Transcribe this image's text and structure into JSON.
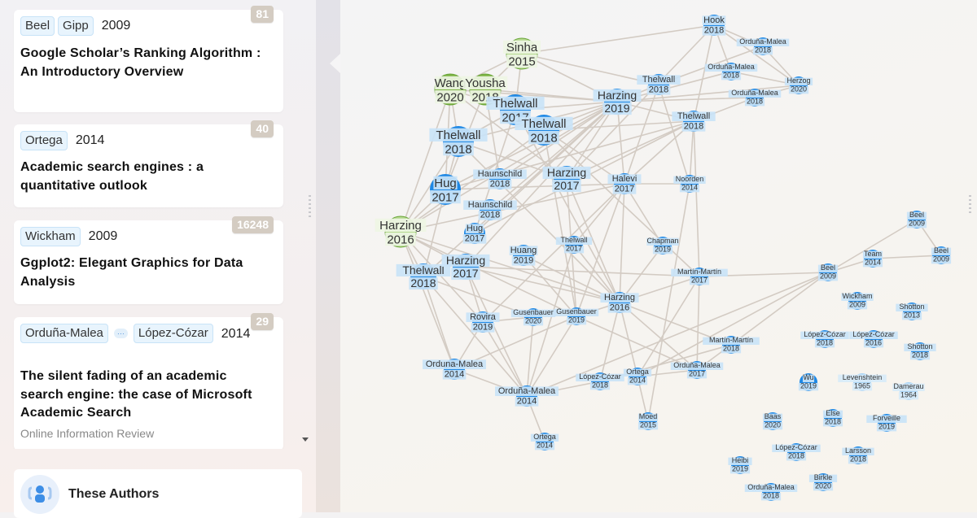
{
  "papers": [
    {
      "authors": [
        "Beel",
        "Gipp"
      ],
      "more_authors": false,
      "year": "2009",
      "title": "Google Scholar’s Ranking Algorithm : An Introductory Overview",
      "venue": "",
      "count": "81"
    },
    {
      "authors": [
        "Ortega"
      ],
      "more_authors": false,
      "year": "2014",
      "title": "Academic search engines : a quantitative outlook",
      "venue": "",
      "count": "40"
    },
    {
      "authors": [
        "Wickham"
      ],
      "more_authors": false,
      "year": "2009",
      "title": "Ggplot2: Elegant Graphics for Data Analysis",
      "venue": "",
      "count": "16248"
    },
    {
      "authors": [
        "Orduña-Malea",
        "López-Cózar"
      ],
      "more_authors": true,
      "more_label": "···",
      "year": "2014",
      "title": "The silent fading of an academic search engine: the case of Microsoft Academic Search",
      "venue": "Online Information Review",
      "count": "29"
    }
  ],
  "authors_panel": {
    "label": "These Authors",
    "icon": "people-group-icon"
  },
  "colors": {
    "node_blue": "#1e88e5",
    "node_light_blue": "#a9d4f5",
    "node_green": "#7cb342",
    "node_green_light": "#b5d98e",
    "edge": "#d3cbc3",
    "count_badge": "#d4ccc2",
    "chip_bg": "#e8f4fd"
  },
  "graph": {
    "nodes": [
      {
        "id": "sinha2015",
        "author": "Sinha",
        "year": "2015",
        "type": "origin-light",
        "size": "lg"
      },
      {
        "id": "wang2020",
        "author": "Wang",
        "year": "2020",
        "type": "origin",
        "size": "lg"
      },
      {
        "id": "yousha2018",
        "author": "Yousha",
        "year": "2018",
        "type": "origin",
        "size": "lg"
      },
      {
        "id": "thelwall2017a",
        "author": "Thelwall",
        "year": "2017",
        "type": "blue",
        "size": "lg"
      },
      {
        "id": "thelwall2018a",
        "author": "Thelwall",
        "year": "2018",
        "type": "blue",
        "size": "lg"
      },
      {
        "id": "thelwall2018b",
        "author": "Thelwall",
        "year": "2018",
        "type": "blue",
        "size": "lg"
      },
      {
        "id": "hug2017a",
        "author": "Hug",
        "year": "2017",
        "type": "blue",
        "size": "lg"
      },
      {
        "id": "harzing2016a",
        "author": "Harzing",
        "year": "2016",
        "type": "origin-light",
        "size": "lg"
      },
      {
        "id": "thelwall2018c",
        "author": "Thelwall",
        "year": "2018",
        "type": "blue",
        "size": "md"
      },
      {
        "id": "harzing2017a",
        "author": "Harzing",
        "year": "2017",
        "type": "blue",
        "size": "md"
      },
      {
        "id": "haunschild2018a",
        "author": "Haunschild",
        "year": "2018",
        "type": "blue",
        "size": "sm"
      },
      {
        "id": "haunschild2018b",
        "author": "Haunschild",
        "year": "2018",
        "type": "blue",
        "size": "sm"
      },
      {
        "id": "hug2017b",
        "author": "Hug",
        "year": "2017",
        "type": "blue",
        "size": "sm"
      },
      {
        "id": "harzing2017b",
        "author": "Harzing",
        "year": "2017",
        "type": "blue",
        "size": "md"
      },
      {
        "id": "harzing2019",
        "author": "Harzing",
        "year": "2019",
        "type": "blue",
        "size": "md"
      },
      {
        "id": "thelwall2018d",
        "author": "Thelwall",
        "year": "2018",
        "type": "blue",
        "size": "sm"
      },
      {
        "id": "thelwall2018e",
        "author": "Thelwall",
        "year": "2018",
        "type": "blue",
        "size": "sm"
      },
      {
        "id": "hook2018",
        "author": "Hook",
        "year": "2018",
        "type": "blue",
        "size": "sm"
      },
      {
        "id": "orduna2018a",
        "author": "Orduña-Malea",
        "year": "2018",
        "type": "blue",
        "size": "xs"
      },
      {
        "id": "orduna2018b",
        "author": "Orduña-Malea",
        "year": "2018",
        "type": "blue",
        "size": "xs"
      },
      {
        "id": "orduna2018c",
        "author": "Orduña-Malea",
        "year": "2018",
        "type": "blue",
        "size": "xs"
      },
      {
        "id": "herzog2020",
        "author": "Herzog",
        "year": "2020",
        "type": "blue",
        "size": "xs"
      },
      {
        "id": "halevi2017",
        "author": "Halevi",
        "year": "2017",
        "type": "blue",
        "size": "sm"
      },
      {
        "id": "noorden2014",
        "author": "Noorden",
        "year": "2014",
        "type": "blue",
        "size": "xs"
      },
      {
        "id": "huang2019",
        "author": "Huang",
        "year": "2019",
        "type": "blue",
        "size": "sm"
      },
      {
        "id": "thelwall2017b",
        "author": "Thelwall",
        "year": "2017",
        "type": "blue",
        "size": "xs"
      },
      {
        "id": "chapman2019",
        "author": "Chapman",
        "year": "2019",
        "type": "blue",
        "size": "xs"
      },
      {
        "id": "martin2017",
        "author": "Martín-Martín",
        "year": "2017",
        "type": "blue",
        "size": "xs"
      },
      {
        "id": "harzing2016b",
        "author": "Harzing",
        "year": "2016",
        "type": "blue",
        "size": "sm"
      },
      {
        "id": "rovira2019",
        "author": "Rovira",
        "year": "2019",
        "type": "blue",
        "size": "sm"
      },
      {
        "id": "gusenbauer2020",
        "author": "Gusenbauer",
        "year": "2020",
        "type": "blue",
        "size": "xs"
      },
      {
        "id": "gusenbauer2019",
        "author": "Gusenbauer",
        "year": "2019",
        "type": "blue",
        "size": "xs"
      },
      {
        "id": "orduna2014a",
        "author": "Orduna-Malea",
        "year": "2014",
        "type": "blue",
        "size": "sm"
      },
      {
        "id": "orduna2014b",
        "author": "Orduña-Malea",
        "year": "2014",
        "type": "blue",
        "size": "sm"
      },
      {
        "id": "lopez2018a",
        "author": "López-Cózar",
        "year": "2018",
        "type": "blue",
        "size": "xs"
      },
      {
        "id": "ortega2014a",
        "author": "Ortega",
        "year": "2014",
        "type": "blue",
        "size": "xs"
      },
      {
        "id": "orduna2017",
        "author": "Orduña-Malea",
        "year": "2017",
        "type": "blue",
        "size": "xs"
      },
      {
        "id": "martin2018",
        "author": "Martín-Martín",
        "year": "2018",
        "type": "blue",
        "size": "xs"
      },
      {
        "id": "moed2015",
        "author": "Moed",
        "year": "2015",
        "type": "blue",
        "size": "xs"
      },
      {
        "id": "ortega2014b",
        "author": "Ortega",
        "year": "2014",
        "type": "blue",
        "size": "xs"
      },
      {
        "id": "beel2009a",
        "author": "Beel",
        "year": "2009",
        "type": "blue",
        "size": "xs"
      },
      {
        "id": "beel2009b",
        "author": "Beel",
        "year": "2009",
        "type": "blue",
        "size": "xs"
      },
      {
        "id": "beel2009c",
        "author": "Beel",
        "year": "2009",
        "type": "blue",
        "size": "xs"
      },
      {
        "id": "team2014",
        "author": "Team",
        "year": "2014",
        "type": "blue",
        "size": "xs"
      },
      {
        "id": "wickham2009",
        "author": "Wickham",
        "year": "2009",
        "type": "blue",
        "size": "xs"
      },
      {
        "id": "shotton2013",
        "author": "Shotton",
        "year": "2013",
        "type": "blue",
        "size": "xs"
      },
      {
        "id": "lopez2018b",
        "author": "López-Cózar",
        "year": "2018",
        "type": "blue",
        "size": "xs"
      },
      {
        "id": "lopez2016",
        "author": "López-Cózar",
        "year": "2016",
        "type": "blue",
        "size": "xs"
      },
      {
        "id": "shotton2018",
        "author": "Shotton",
        "year": "2018",
        "type": "blue",
        "size": "xs"
      },
      {
        "id": "wu2019",
        "author": "Wu",
        "year": "2019",
        "type": "blue",
        "size": "xs"
      },
      {
        "id": "levenshtein1965",
        "author": "Levenshtein",
        "year": "1965",
        "type": "light",
        "size": "xs"
      },
      {
        "id": "damerau1964",
        "author": "Damerau",
        "year": "1964",
        "type": "light",
        "size": "xs"
      },
      {
        "id": "baas2020",
        "author": "Baas",
        "year": "2020",
        "type": "blue",
        "size": "xs"
      },
      {
        "id": "else2018",
        "author": "Else",
        "year": "2018",
        "type": "blue",
        "size": "xs"
      },
      {
        "id": "forveille2019",
        "author": "Forveille",
        "year": "2019",
        "type": "blue",
        "size": "xs"
      },
      {
        "id": "lopez2018c",
        "author": "López-Cózar",
        "year": "2018",
        "type": "blue",
        "size": "xs"
      },
      {
        "id": "larsson2018",
        "author": "Larsson",
        "year": "2018",
        "type": "blue",
        "size": "xs"
      },
      {
        "id": "heibi2019",
        "author": "Heibi",
        "year": "2019",
        "type": "blue",
        "size": "xs"
      },
      {
        "id": "birkle2020",
        "author": "Birkle",
        "year": "2020",
        "type": "blue",
        "size": "xs"
      },
      {
        "id": "orduna2018d",
        "author": "Orduña-Malea",
        "year": "2018",
        "type": "blue",
        "size": "xs"
      },
      {
        "id": "ortega2014c",
        "author": "Ortega",
        "year": "2014",
        "type": "blue",
        "size": "xs"
      }
    ]
  }
}
